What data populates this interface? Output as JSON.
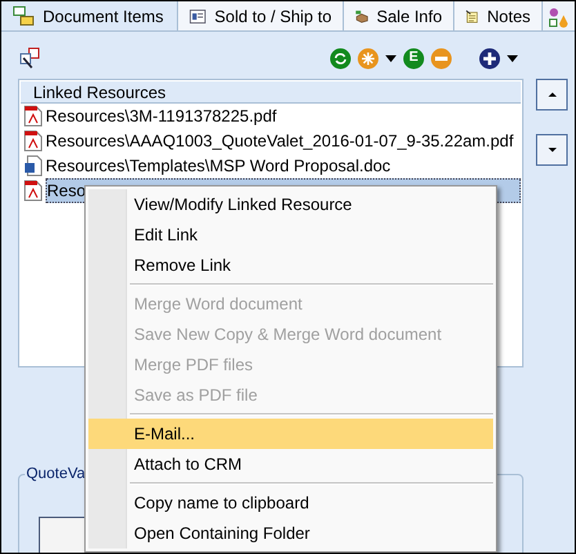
{
  "tabs": [
    {
      "label": "Document Items",
      "selected": true
    },
    {
      "label": "Sold to / Ship to",
      "selected": false
    },
    {
      "label": "Sale Info",
      "selected": false
    },
    {
      "label": "Notes",
      "selected": false
    }
  ],
  "toolbar": {
    "e_button_label": "E"
  },
  "linked_resources": {
    "header": "Linked Resources",
    "rows": [
      {
        "kind": "pdf",
        "name": "Resources\\3M-1191378225.pdf",
        "selected": false
      },
      {
        "kind": "pdf",
        "name": "Resources\\AAAQ1003_QuoteValet_2016-01-07_9-35.22am.pdf",
        "selected": false
      },
      {
        "kind": "word",
        "name": "Resources\\Templates\\MSP Word Proposal.doc",
        "selected": false
      },
      {
        "kind": "pdf",
        "name": "Reso",
        "selected": true
      }
    ]
  },
  "group": {
    "title": "QuoteVa"
  },
  "context_menu": [
    {
      "kind": "item",
      "label": "View/Modify Linked Resource",
      "disabled": false,
      "selected": false
    },
    {
      "kind": "item",
      "label": "Edit Link",
      "disabled": false,
      "selected": false
    },
    {
      "kind": "item",
      "label": "Remove Link",
      "disabled": false,
      "selected": false
    },
    {
      "kind": "separator"
    },
    {
      "kind": "item",
      "label": "Merge Word document",
      "disabled": true,
      "selected": false
    },
    {
      "kind": "item",
      "label": "Save New Copy & Merge Word document",
      "disabled": true,
      "selected": false
    },
    {
      "kind": "item",
      "label": "Merge PDF files",
      "disabled": true,
      "selected": false
    },
    {
      "kind": "item",
      "label": "Save as PDF file",
      "disabled": true,
      "selected": false
    },
    {
      "kind": "separator"
    },
    {
      "kind": "item",
      "label": "E-Mail...",
      "disabled": false,
      "selected": true
    },
    {
      "kind": "item",
      "label": "Attach to CRM",
      "disabled": false,
      "selected": false
    },
    {
      "kind": "separator"
    },
    {
      "kind": "item",
      "label": "Copy name to clipboard",
      "disabled": false,
      "selected": false
    },
    {
      "kind": "item",
      "label": "Open Containing Folder",
      "disabled": false,
      "selected": false
    }
  ]
}
